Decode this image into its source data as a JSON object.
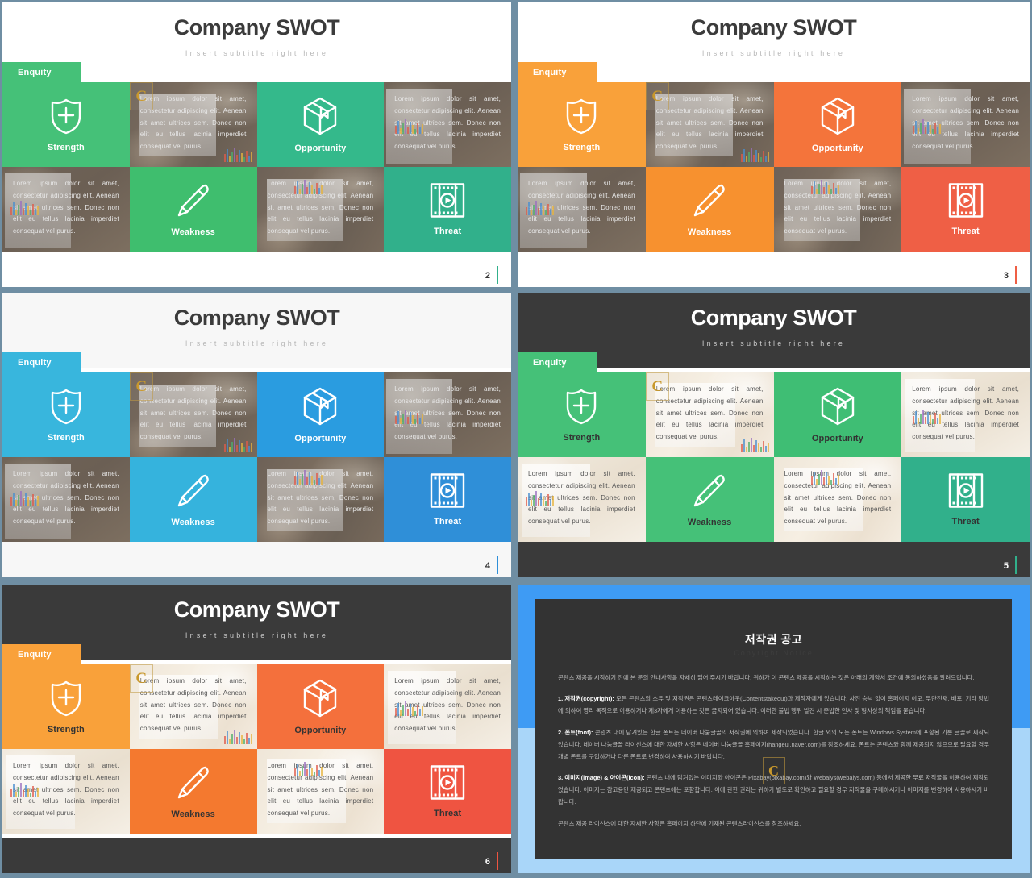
{
  "common": {
    "title": "Company SWOT",
    "subtitle": "Insert subtitle right here",
    "tab_label": "Enquity",
    "body_text": "Lorem ipsum dolor sit amet, consectetur adipiscing elit. Aenean sit amet ultrices sem. Donec non elit eu tellus lacinia imperdiet consequat vel purus.",
    "watermark": "C",
    "quadrants": [
      {
        "label": "Strength",
        "icon": "shield-plus-icon"
      },
      {
        "label": "Opportunity",
        "icon": "box-3d-icon"
      },
      {
        "label": "Weakness",
        "icon": "pencil-icon"
      },
      {
        "label": "Threat",
        "icon": "film-play-icon"
      }
    ]
  },
  "slides": [
    {
      "page": "2",
      "theme": "green-light",
      "header_bg": "#ffffff",
      "title_color": "#3b3b3b",
      "subtitle_color": "#b7b7b7",
      "footer_bg": "#ffffff",
      "page_color": "#333333",
      "tab_bg": "#45c178",
      "accent_strength": "#45c178",
      "accent_opportunity": "#34b98b",
      "accent_weakness": "#3fbe6e",
      "accent_threat": "#31b08b",
      "icon_color": "#ffffff",
      "label_color": "#ffffff",
      "photo_style": "dark",
      "photo_text_color": "#e8e8e8",
      "bar_color": "#45c178"
    },
    {
      "page": "3",
      "theme": "orange-light",
      "header_bg": "#ffffff",
      "title_color": "#3b3b3b",
      "subtitle_color": "#b7b7b7",
      "footer_bg": "#ffffff",
      "page_color": "#333333",
      "tab_bg": "#f9a13a",
      "accent_strength": "#f9a13a",
      "accent_opportunity": "#f4743b",
      "accent_weakness": "#f7912f",
      "accent_threat": "#ef5f45",
      "icon_color": "#ffffff",
      "label_color": "#ffffff",
      "photo_style": "dark",
      "photo_text_color": "#e8e8e8",
      "bar_color": "#f9a13a"
    },
    {
      "page": "4",
      "theme": "blue-light",
      "header_bg": "#f7f7f7",
      "title_color": "#3b3b3b",
      "subtitle_color": "#b7b7b7",
      "footer_bg": "#f7f7f7",
      "page_color": "#333333",
      "tab_bg": "#38b6dd",
      "accent_strength": "#38b6dd",
      "accent_opportunity": "#2a9ce0",
      "accent_weakness": "#35b3dd",
      "accent_threat": "#2f8fd8",
      "icon_color": "#ffffff",
      "label_color": "#ffffff",
      "photo_style": "dark",
      "photo_text_color": "#e8e8e8",
      "bar_color": "#38b6dd"
    },
    {
      "page": "5",
      "theme": "green-dark",
      "header_bg": "#3a3a3a",
      "title_color": "#ffffff",
      "subtitle_color": "#c9c9c9",
      "footer_bg": "#3a3a3a",
      "page_color": "#ffffff",
      "tab_bg": "#45c178",
      "accent_strength": "#45c178",
      "accent_opportunity": "#3fbe74",
      "accent_weakness": "#45c178",
      "accent_threat": "#31b08b",
      "icon_color": "#ffffff",
      "label_color": "#333333",
      "photo_style": "light",
      "photo_text_color": "#555555",
      "bar_color": "#45c178"
    },
    {
      "page": "6",
      "theme": "orange-dark",
      "header_bg": "#3a3a3a",
      "title_color": "#ffffff",
      "subtitle_color": "#c9c9c9",
      "footer_bg": "#3a3a3a",
      "page_color": "#ffffff",
      "tab_bg": "#f9a13a",
      "accent_strength": "#f9a13a",
      "accent_opportunity": "#f4703c",
      "accent_weakness": "#f4792f",
      "accent_threat": "#ef5441",
      "icon_color": "#ffffff",
      "label_color": "#333333",
      "photo_style": "light",
      "photo_text_color": "#555555",
      "bar_color": "#f9a13a"
    }
  ],
  "copyright": {
    "band_top_color": "#3e9bf4",
    "band_bottom_color": "#a9d6f9",
    "panel_color": "#333333",
    "title": "저작권 공고",
    "subtitle": "Copyright Notice",
    "watermark": "C",
    "intro": "콘텐츠 제공을 시작하기 전에 본 문의 안내사항을 자세히 읽어 주시기 바랍니다. 귀하가 이 콘텐츠 제공을 시작하는 것은 아래의 계약서 조건에 동의하셨음을 알려드립니다.",
    "sections": [
      {
        "heading": "1. 저작권(copyright):",
        "text": "모든 콘텐츠의 소유 및 저작권은 콘텐츠테이크아웃(Contentstakeout)과 제작자에게 있습니다. 사전 승낙 없이 홈페이지 이모, 무단전재, 배포, 기타 방법에 의하여 영리 목적으로 이용하거나 제3자에게 이용하는 것은 금지되어 있습니다. 이러한 불법 행위 발견 시 준법한 민사 및 형사상의 책임을 묻습니다."
      },
      {
        "heading": "2. 폰트(font):",
        "text": "콘텐츠 내에 담겨있는 한글 폰트는 네이버 나눔글꼴의 저작권에 의하여 제작되었습니다. 한글 외의 모든 폰트는 Windows System에 포함된 기본 글꼴로 제작되었습니다. 네이버 나눔글꼴 라이선스에 대한 자세한 사항은 네이버 나눔글꼴 홈페이지(hangeul.naver.com)를 참조하세요. 폰트는 콘텐츠와 함께 제공되지 않으므로 필요할 경우 개별 폰트를 구입하거나 다른 폰트로 변경하여 사용하시기 바랍니다."
      },
      {
        "heading": "3. 이미지(image) & 아이콘(icon):",
        "text": "콘텐츠 내에 담겨있는 이미지와 아이콘은 Pixabay(pixabay.com)와 Webalys(webalys.com) 등에서 제공한 무료 저작물을 이용하여 제작되었습니다. 이미지는 참고용만 제공되고 콘텐츠에는 포함합니다. 이에 관한 권리는 귀하가 별도로 확인하고 필요할 경우 저작물을 구매하시거나 이미지를 변경하여 사용하시기 바랍니다."
      }
    ],
    "outro": "콘텐츠 제공 라이선스에 대한 자세한 사항은 홈페이지 하단에 기재된 콘텐츠라이선스를 참조하세요."
  }
}
